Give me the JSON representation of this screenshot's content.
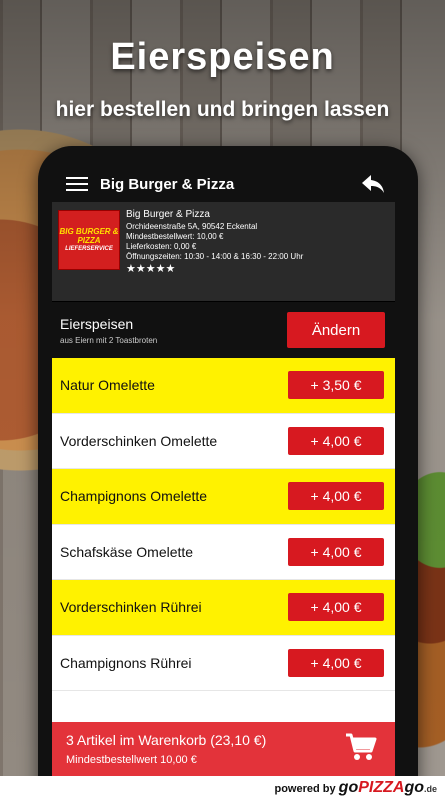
{
  "headline": "Eierspeisen",
  "subline": "hier bestellen und bringen lassen",
  "appbar": {
    "title": "Big Burger & Pizza"
  },
  "restaurant": {
    "logo_line1": "BIG BURGER & PIZZA",
    "logo_line2": "LIEFERSERVICE",
    "name": "Big Burger & Pizza",
    "address": "Orchideenstraße 5A, 90542 Eckental",
    "min_order": "Mindestbestellwert: 10,00 €",
    "delivery_cost": "Lieferkosten: 0,00 €",
    "hours": "Öffnungszeiten: 10:30 - 14:00 & 16:30 - 22:00 Uhr",
    "rating_stars": "★★★★★",
    "rating": 5
  },
  "category": {
    "title": "Eierspeisen",
    "subtitle": "aus Eiern mit 2 Toastbroten",
    "change_label": "Ändern"
  },
  "products": [
    {
      "name": "Natur Omelette",
      "price": "+ 3,50 €"
    },
    {
      "name": "Vorderschinken Omelette",
      "price": "+ 4,00 €"
    },
    {
      "name": "Champignons Omelette",
      "price": "+ 4,00 €"
    },
    {
      "name": "Schafskäse Omelette",
      "price": "+ 4,00 €"
    },
    {
      "name": "Vorderschinken Rührei",
      "price": "+ 4,00 €"
    },
    {
      "name": "Champignons Rührei",
      "price": "+ 4,00 €"
    }
  ],
  "cart": {
    "summary": "3 Artikel im Warenkorb (23,10 €)",
    "min_order": "Mindestbestellwert 10,00 €"
  },
  "footer": {
    "powered_by": "powered by",
    "brand_prefix": "go",
    "brand_main": "PIZZA",
    "brand_suffix": "go",
    "brand_tld": ".de"
  },
  "colors": {
    "accent_red": "#d71920",
    "highlight_yellow": "#fff200",
    "cart_red": "#e3333a"
  }
}
